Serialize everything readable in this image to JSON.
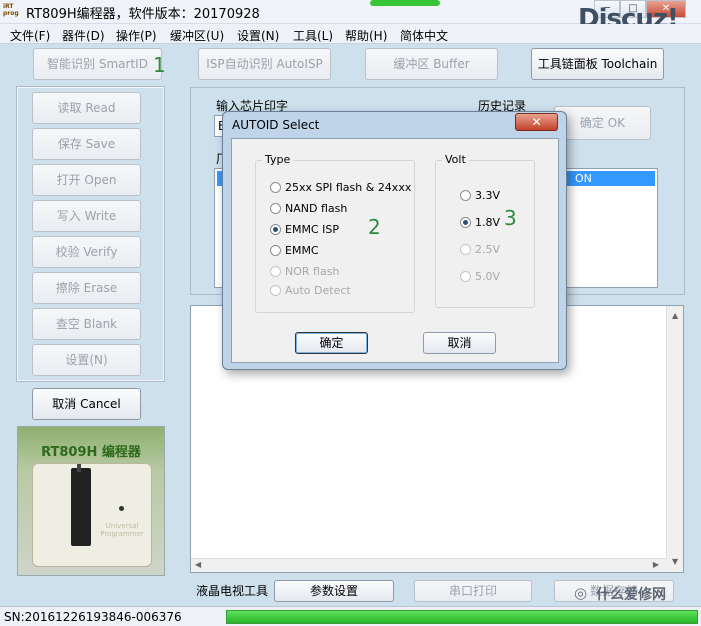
{
  "window": {
    "title": "RT809H编程器，软件版本：20170928",
    "app_icon_text": "iRT\nprog",
    "controls": {
      "minimize": "─",
      "maximize": "□",
      "close": "✕"
    },
    "brand_watermark": "Discuz!"
  },
  "menu": [
    "文件(F)",
    "器件(D)",
    "操作(P)",
    "缓冲区(U)",
    "设置(N)",
    "工具(L)",
    "帮助(H)",
    "简体中文"
  ],
  "toolbar": {
    "smartid": "智能识别 SmartID",
    "smartid_mark": "1",
    "autoisp": "ISP自动识别 AutoISP",
    "buffer": "缓冲区 Buffer",
    "toolchain": "工具链面板 Toolchain"
  },
  "sidebar": {
    "buttons": [
      "读取 Read",
      "保存 Save",
      "打开 Open",
      "写入 Write",
      "校验 Verify",
      "擦除 Erase",
      "查空 Blank",
      "设置(N)"
    ],
    "cancel": "取消 Cancel",
    "product_label": "RT809H 编程器",
    "device_text": "Universal Programmer"
  },
  "main": {
    "chip_input_label": "输入芯片印字",
    "chip_input_value": "E",
    "history_label": "历史记录",
    "ok_button": "确定 OK",
    "list_prefix": "厂",
    "list_selected_suffix": "ON",
    "lcd_tool_label": "液晶电视工具",
    "param_button": "参数设置",
    "serial_button": "串口打印",
    "last_button": "数据存储"
  },
  "dialog": {
    "title": "AUTOID Select",
    "close_symbol": "✕",
    "type_group": "Type",
    "types": [
      {
        "label": "25xx SPI flash & 24xxx",
        "checked": false,
        "disabled": false
      },
      {
        "label": "NAND flash",
        "checked": false,
        "disabled": false
      },
      {
        "label": "EMMC ISP",
        "checked": true,
        "disabled": false
      },
      {
        "label": "EMMC",
        "checked": false,
        "disabled": false
      },
      {
        "label": "NOR flash",
        "checked": false,
        "disabled": true
      },
      {
        "label": "Auto Detect",
        "checked": false,
        "disabled": true
      }
    ],
    "type_mark": "2",
    "volt_group": "Volt",
    "volts": [
      {
        "label": "3.3V",
        "checked": false,
        "disabled": false
      },
      {
        "label": "1.8V",
        "checked": true,
        "disabled": false
      },
      {
        "label": "2.5V",
        "checked": false,
        "disabled": true
      },
      {
        "label": "5.0V",
        "checked": false,
        "disabled": true
      }
    ],
    "volt_mark": "3",
    "ok": "确定",
    "cancel": "取消"
  },
  "status": {
    "sn": "SN:20161226193846-006376",
    "progress_percent": 100,
    "watermark": "什么爱修网"
  },
  "colors": {
    "client_bg": "#cde0ec",
    "progress_green": "#2fc02f",
    "selection_blue": "#3399ff",
    "dialog_close_red": "#c2422c",
    "annotation_green": "#2e8b3e"
  }
}
